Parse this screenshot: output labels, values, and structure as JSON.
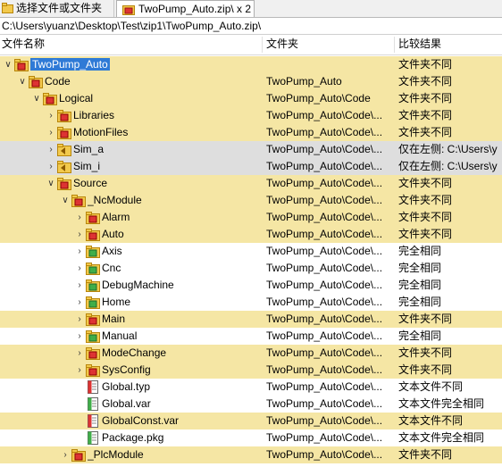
{
  "tabs": [
    {
      "label": "选择文件或文件夹"
    },
    {
      "label": "TwoPump_Auto.zip\\ x 2"
    }
  ],
  "path": "C:\\Users\\yuanz\\Desktop\\Test\\zip1\\TwoPump_Auto.zip\\",
  "columns": {
    "name": "文件名称",
    "folder": "文件夹",
    "result": "比较结果"
  },
  "colors": {
    "diff": "#f5e6a4",
    "orphan": "#dedede",
    "selection": "#2f7ad6"
  },
  "rows": [
    {
      "name": "TwoPump_Auto",
      "folder": "",
      "result": "文件夹不同",
      "depth": 0,
      "expander": "open",
      "icon": "folder-diff-icon",
      "bg": "hl",
      "selected": true
    },
    {
      "name": "Code",
      "folder": "TwoPump_Auto",
      "result": "文件夹不同",
      "depth": 1,
      "expander": "open",
      "icon": "folder-diff-icon",
      "bg": "hl"
    },
    {
      "name": "Logical",
      "folder": "TwoPump_Auto\\Code",
      "result": "文件夹不同",
      "depth": 2,
      "expander": "open",
      "icon": "folder-diff-icon",
      "bg": "hl"
    },
    {
      "name": "Libraries",
      "folder": "TwoPump_Auto\\Code\\...",
      "result": "文件夹不同",
      "depth": 3,
      "expander": "closed",
      "icon": "folder-diff-icon",
      "bg": "hl"
    },
    {
      "name": "MotionFiles",
      "folder": "TwoPump_Auto\\Code\\...",
      "result": "文件夹不同",
      "depth": 3,
      "expander": "closed",
      "icon": "folder-diff-icon",
      "bg": "hl"
    },
    {
      "name": "Sim_a",
      "folder": "TwoPump_Auto\\Code\\...",
      "result": "仅在左侧: C:\\Users\\y",
      "depth": 3,
      "expander": "closed",
      "icon": "folder-left-icon",
      "bg": "gray"
    },
    {
      "name": "Sim_i",
      "folder": "TwoPump_Auto\\Code\\...",
      "result": "仅在左侧: C:\\Users\\y",
      "depth": 3,
      "expander": "closed",
      "icon": "folder-left-icon",
      "bg": "gray"
    },
    {
      "name": "Source",
      "folder": "TwoPump_Auto\\Code\\...",
      "result": "文件夹不同",
      "depth": 3,
      "expander": "open",
      "icon": "folder-diff-icon",
      "bg": "hl"
    },
    {
      "name": "_NcModule",
      "folder": "TwoPump_Auto\\Code\\...",
      "result": "文件夹不同",
      "depth": 4,
      "expander": "open",
      "icon": "folder-diff-icon",
      "bg": "hl"
    },
    {
      "name": "Alarm",
      "folder": "TwoPump_Auto\\Code\\...",
      "result": "文件夹不同",
      "depth": 5,
      "expander": "closed",
      "icon": "folder-diff-icon",
      "bg": "hl"
    },
    {
      "name": "Auto",
      "folder": "TwoPump_Auto\\Code\\...",
      "result": "文件夹不同",
      "depth": 5,
      "expander": "closed",
      "icon": "folder-diff-icon",
      "bg": "hl"
    },
    {
      "name": "Axis",
      "folder": "TwoPump_Auto\\Code\\...",
      "result": "完全相同",
      "depth": 5,
      "expander": "closed",
      "icon": "folder-same-icon",
      "bg": ""
    },
    {
      "name": "Cnc",
      "folder": "TwoPump_Auto\\Code\\...",
      "result": "完全相同",
      "depth": 5,
      "expander": "closed",
      "icon": "folder-same-icon",
      "bg": ""
    },
    {
      "name": "DebugMachine",
      "folder": "TwoPump_Auto\\Code\\...",
      "result": "完全相同",
      "depth": 5,
      "expander": "closed",
      "icon": "folder-same-icon",
      "bg": ""
    },
    {
      "name": "Home",
      "folder": "TwoPump_Auto\\Code\\...",
      "result": "完全相同",
      "depth": 5,
      "expander": "closed",
      "icon": "folder-same-icon",
      "bg": ""
    },
    {
      "name": "Main",
      "folder": "TwoPump_Auto\\Code\\...",
      "result": "文件夹不同",
      "depth": 5,
      "expander": "closed",
      "icon": "folder-diff-icon",
      "bg": "hl"
    },
    {
      "name": "Manual",
      "folder": "TwoPump_Auto\\Code\\...",
      "result": "完全相同",
      "depth": 5,
      "expander": "closed",
      "icon": "folder-same-icon",
      "bg": ""
    },
    {
      "name": "ModeChange",
      "folder": "TwoPump_Auto\\Code\\...",
      "result": "文件夹不同",
      "depth": 5,
      "expander": "closed",
      "icon": "folder-diff-icon",
      "bg": "hl"
    },
    {
      "name": "SysConfig",
      "folder": "TwoPump_Auto\\Code\\...",
      "result": "文件夹不同",
      "depth": 5,
      "expander": "closed",
      "icon": "folder-diff-icon",
      "bg": "hl"
    },
    {
      "name": "Global.typ",
      "folder": "TwoPump_Auto\\Code\\...",
      "result": "文本文件不同",
      "depth": 5,
      "expander": "none",
      "icon": "file-diff-icon",
      "bg": ""
    },
    {
      "name": "Global.var",
      "folder": "TwoPump_Auto\\Code\\...",
      "result": "文本文件完全相同",
      "depth": 5,
      "expander": "none",
      "icon": "file-same-icon",
      "bg": ""
    },
    {
      "name": "GlobalConst.var",
      "folder": "TwoPump_Auto\\Code\\...",
      "result": "文本文件不同",
      "depth": 5,
      "expander": "none",
      "icon": "file-diff-icon",
      "bg": "hl"
    },
    {
      "name": "Package.pkg",
      "folder": "TwoPump_Auto\\Code\\...",
      "result": "文本文件完全相同",
      "depth": 5,
      "expander": "none",
      "icon": "file-same-icon",
      "bg": ""
    },
    {
      "name": "_PlcModule",
      "folder": "TwoPump_Auto\\Code\\...",
      "result": "文件夹不同",
      "depth": 4,
      "expander": "closed",
      "icon": "folder-diff-icon",
      "bg": "hl"
    }
  ]
}
